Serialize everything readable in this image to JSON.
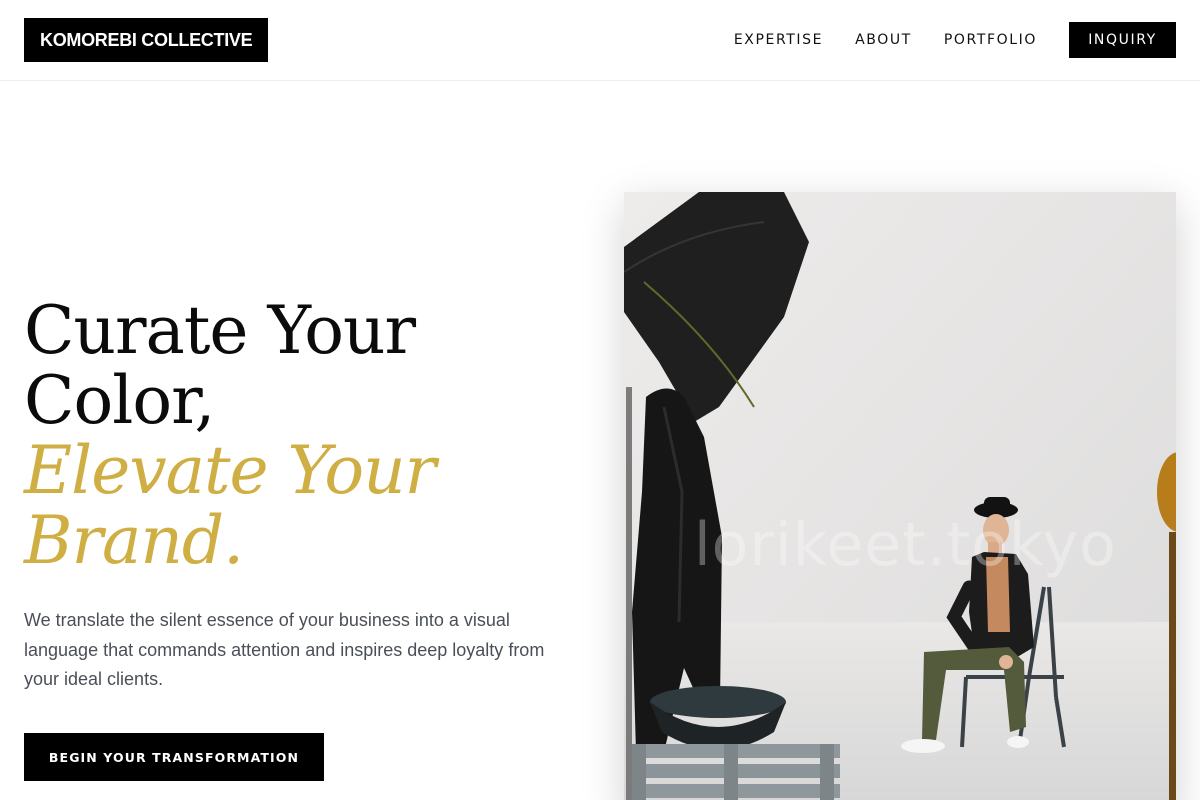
{
  "header": {
    "logo": "KOMOREBI COLLECTIVE",
    "nav": [
      {
        "label": "EXPERTISE"
      },
      {
        "label": "ABOUT"
      },
      {
        "label": "PORTFOLIO"
      }
    ],
    "cta": "INQUIRY"
  },
  "hero": {
    "title_line1": "Curate Your",
    "title_line2": "Color,",
    "title_line3": "Elevate Your",
    "title_line4": "Brand.",
    "description": "We translate the silent essence of your business into a visual language that commands attention and inspires deep loyalty from your ideal clients.",
    "cta": "BEGIN YOUR TRANSFORMATION",
    "image_watermark": "lorikeet.tokyo"
  },
  "colors": {
    "accent": "#cfae43",
    "button_bg": "#000000",
    "body_text": "#4a4f57"
  }
}
